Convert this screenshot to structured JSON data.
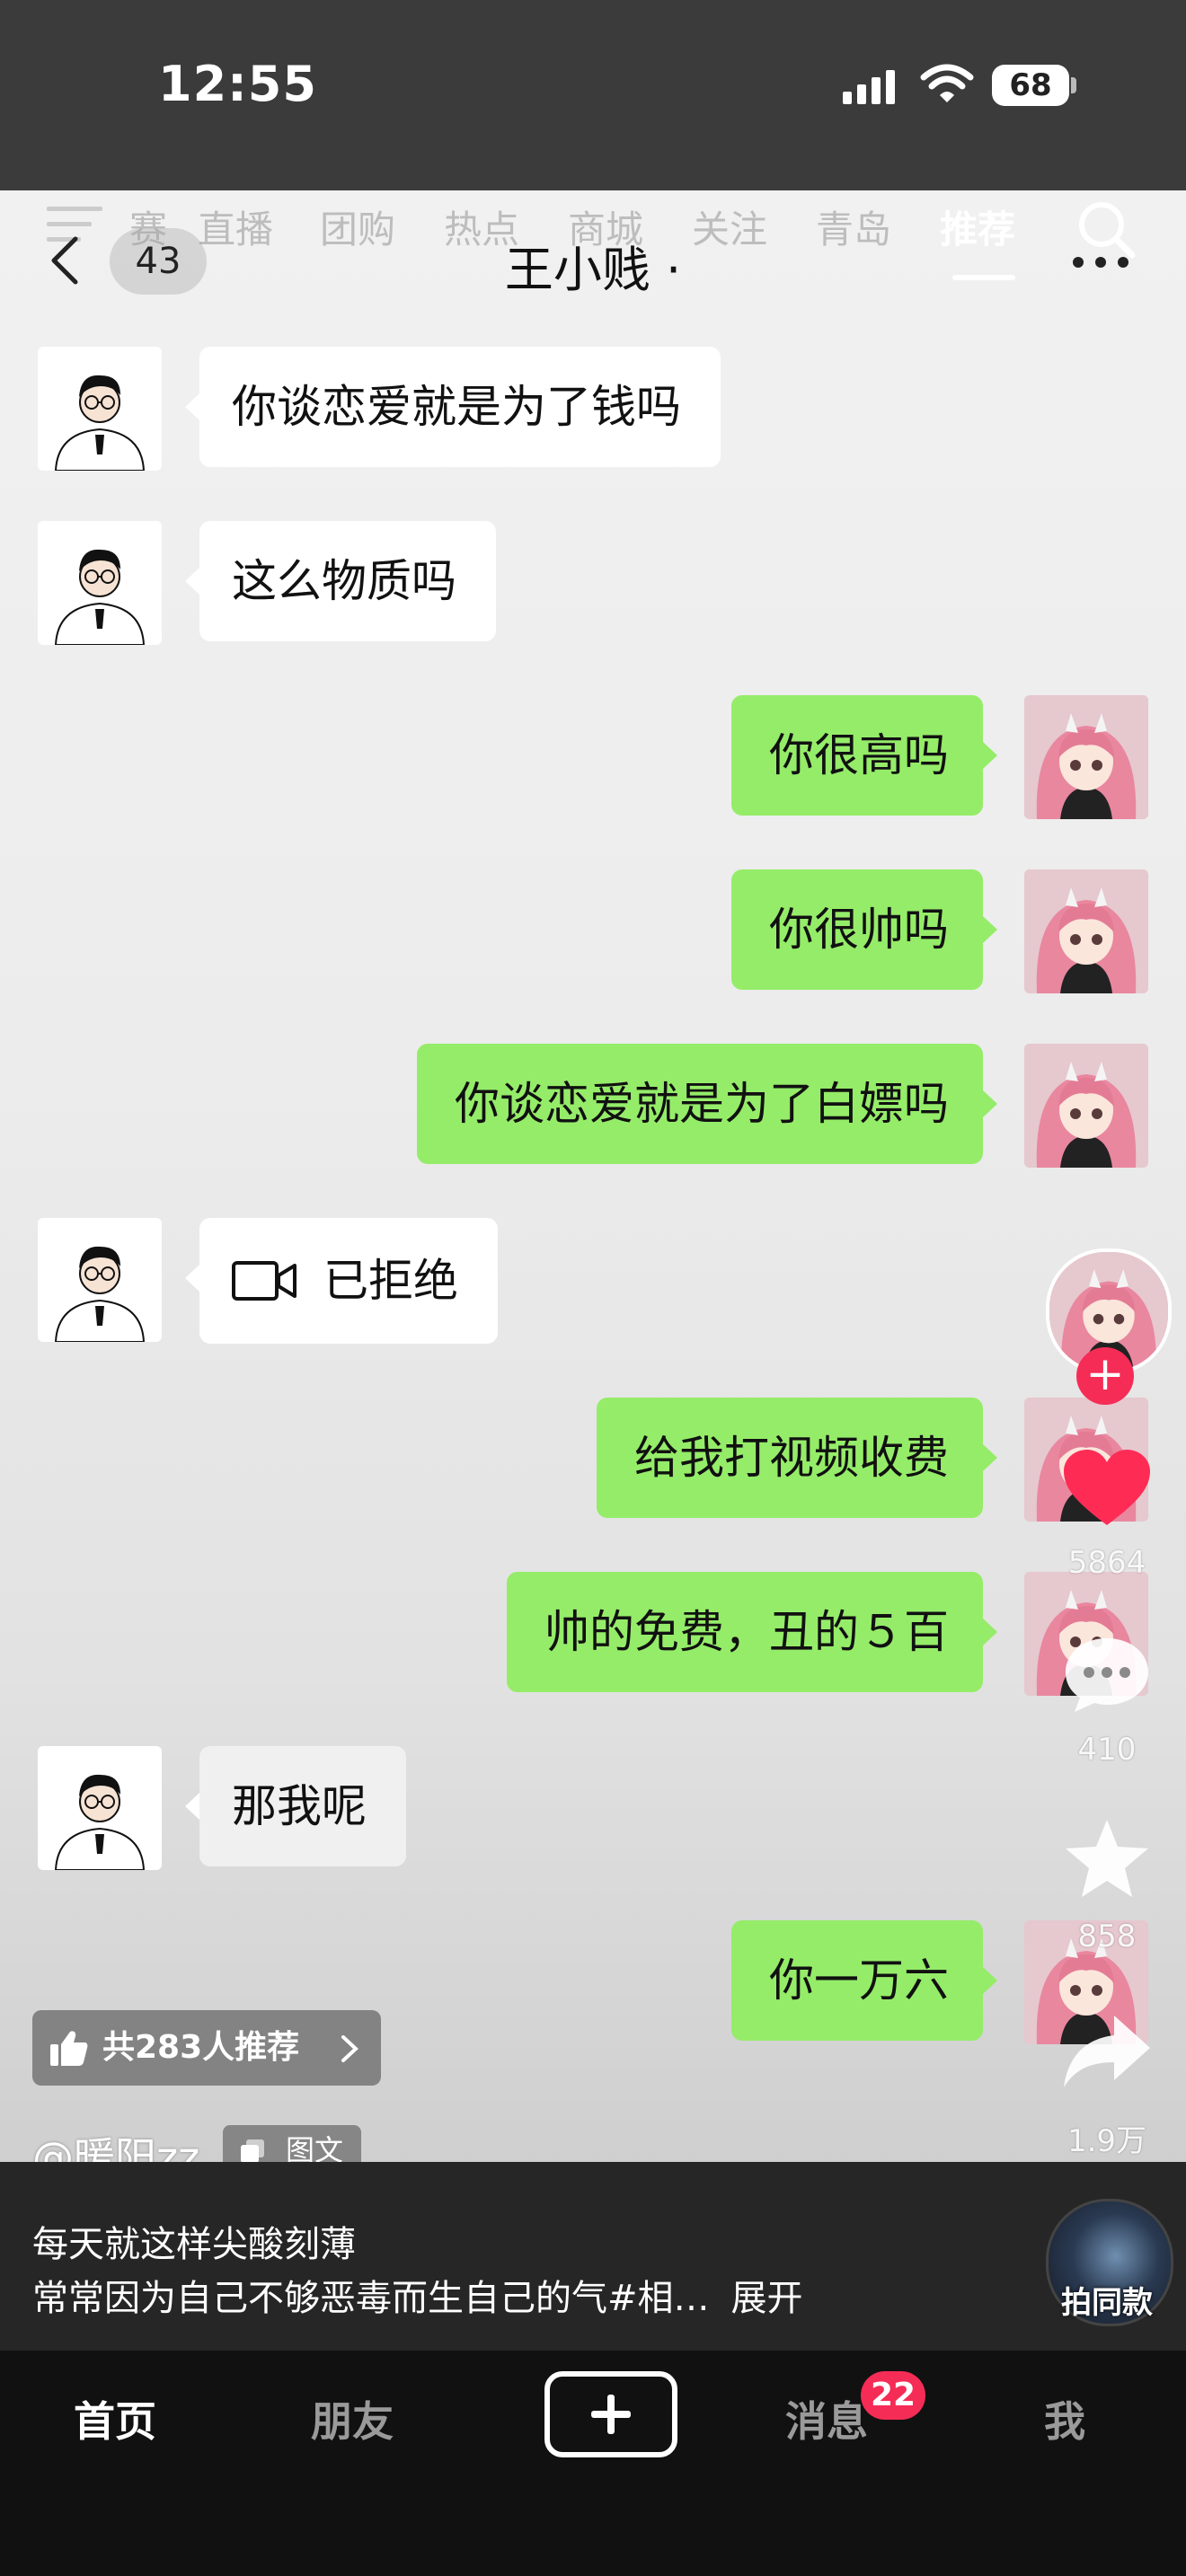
{
  "status_bar": {
    "time": "12:55",
    "battery": "68",
    "icons": [
      "cellular-signal-icon",
      "wifi-icon",
      "battery-icon"
    ]
  },
  "channel_tabs": {
    "items": [
      "赛",
      "直播",
      "团购",
      "热点",
      "商城",
      "关注",
      "青岛",
      "推荐"
    ],
    "active": "推荐"
  },
  "chat_header": {
    "unread_count": "43",
    "title": "王小贱 ·"
  },
  "messages": [
    {
      "side": "left",
      "text": "你谈恋爱就是为了钱吗"
    },
    {
      "side": "left",
      "text": "这么物质吗"
    },
    {
      "side": "right",
      "text": "你很高吗"
    },
    {
      "side": "right",
      "text": "你很帅吗"
    },
    {
      "side": "right",
      "text": "你谈恋爱就是为了白嫖吗"
    },
    {
      "side": "left",
      "text": "已拒绝",
      "icon": "video-call-icon"
    },
    {
      "side": "right",
      "text": "给我打视频收费"
    },
    {
      "side": "right",
      "text": "帅的免费，丑的５百"
    },
    {
      "side": "left",
      "text": "那我呢"
    },
    {
      "side": "right",
      "text": "你一万六"
    }
  ],
  "actions": {
    "likes": "5864",
    "comments": "410",
    "favorites": "858",
    "shares": "1.9万",
    "colors": {
      "like": "#fe2c55",
      "follow": "#f52c56"
    }
  },
  "recommend": {
    "text": "共283人推荐"
  },
  "author": {
    "name": "@暖阳zz",
    "type_badge": "图文"
  },
  "caption": {
    "line1": "每天就这样尖酸刻薄",
    "line2": "常常因为自己不够恶毒而生自己的气#相…",
    "expand": "展开"
  },
  "music": {
    "label": "拍同款"
  },
  "bottom_nav": {
    "home": "首页",
    "friends": "朋友",
    "messages": "消息",
    "messages_badge": "22",
    "me": "我"
  }
}
